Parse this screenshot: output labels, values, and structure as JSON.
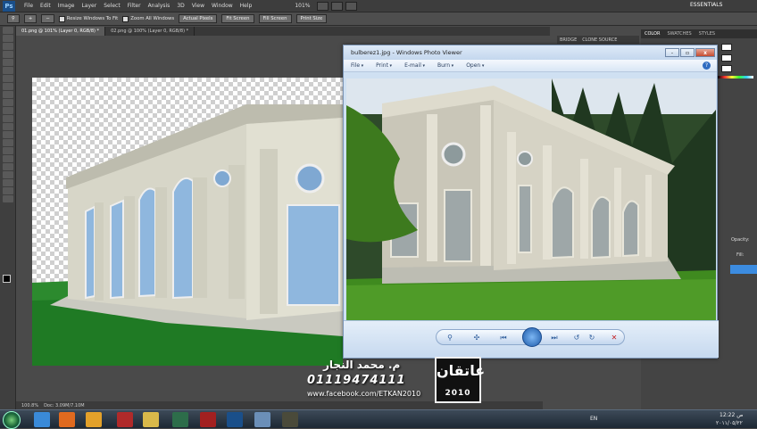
{
  "photoshop": {
    "logo": "Ps",
    "menu": [
      "File",
      "Edit",
      "Image",
      "Layer",
      "Select",
      "Filter",
      "Analysis",
      "3D",
      "View",
      "Window",
      "Help"
    ],
    "zoom": "101%",
    "workspace": "ESSENTIALS",
    "options": {
      "resize_windows": "Resize Windows To Fit",
      "zoom_all": "Zoom All Windows",
      "actual_pixels": "Actual Pixels",
      "fit_screen": "Fit Screen",
      "fill_screen": "Fill Screen",
      "print_size": "Print Size"
    },
    "tabs": [
      "01.png @ 101% (Layer 0, RGB/8) *",
      "02.png @ 100% (Layer 0, RGB/8) *"
    ],
    "status": {
      "zoom": "100.8%",
      "doc": "Doc: 3.09M/7.10M"
    },
    "mini_tabs": [
      "BRIDGE",
      "CLONE SOURCE"
    ],
    "panel_tabs": [
      "COLOR",
      "SWATCHES",
      "STYLES"
    ],
    "layer_labels": {
      "opacity": "Opacity:",
      "fill": "Fill:"
    }
  },
  "photo_viewer": {
    "title": "bulberez1.jpg - Windows Photo Viewer",
    "menu": [
      "File",
      "Print",
      "E-mail",
      "Burn",
      "Open"
    ],
    "help": "?",
    "window_controls": {
      "minimize": "-",
      "restore": "▫",
      "close": "x"
    },
    "toolbar": {
      "zoom": "⚲",
      "actual_size": "✣",
      "prev": "⏮",
      "next": "⏭",
      "rotate_ccw": "↺",
      "rotate_cw": "↻",
      "delete": "✕"
    }
  },
  "watermark": {
    "name": "م. محمد النجار",
    "phone": "01119474111",
    "url": "www.facebook.com/ETKAN2010",
    "logo_text": "عاتقان",
    "logo_year": "2010"
  },
  "taskbar": {
    "lang": "EN",
    "time": "12:22 ص",
    "date": "٢٠١١/٠٥/٢٢"
  },
  "colors": {
    "ps_dark": "#3d3d3d",
    "viewer_chrome": "#cfe0f2",
    "taskbar": "#1d2834",
    "accent_blue": "#3c8ce0"
  }
}
